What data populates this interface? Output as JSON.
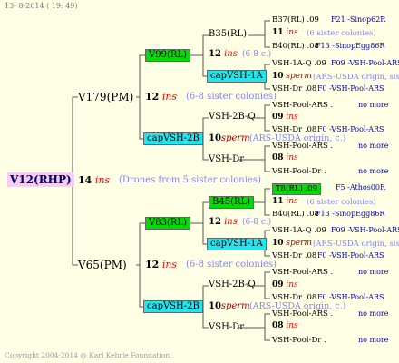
{
  "date": "13- 8-2014 ( 19: 49)",
  "root": "V12(RHP)",
  "root_ins": {
    "num": "14",
    "type": "ins",
    "note": "(Drones from 5 sister colonies)"
  },
  "sire_line": {
    "name": "V179(PM)",
    "ins": {
      "num": "12",
      "type": "ins",
      "note": "(6-8 sister colonies)"
    },
    "a": {
      "name": "V99(RL)",
      "ins": {
        "num": "12",
        "type": "ins",
        "note": "(6-8 c.)"
      },
      "a": {
        "name": "B35(RL)",
        "ins": {
          "num": "11",
          "type": "ins",
          "note": "(6 sister colonies)"
        },
        "a": {
          "name": "B37(RL) .09",
          "extra": "F21 -Sinop62R"
        },
        "b": {
          "name": "B40(RL) .08",
          "extra": "F13 -SinopEgg86R"
        }
      },
      "b": {
        "name": "capVSH-1A",
        "ins": {
          "num": "10",
          "type": "sperm",
          "note": "(ARS-USDA origin, sister"
        },
        "a": {
          "name": "VSH-1A-Q .09",
          "extra": "F09 -VSH-Pool-ARS"
        },
        "b": {
          "name": "VSH-Dr .08",
          "extra": "F0 -VSH-Pool-ARS"
        }
      }
    },
    "b": {
      "name": "capVSH-2B",
      "ins": {
        "num": "10",
        "type": "sperm",
        "note": "(ARS-USDA origin, c.)"
      },
      "a": {
        "name": "VSH-2B-Q",
        "ins": {
          "num": "09",
          "type": "ins",
          "note": ""
        },
        "a": {
          "name": "VSH-Pool-ARS .",
          "extra": "no more"
        },
        "b": {
          "name": "VSH-Dr .08",
          "extra": "F0 -VSH-Pool-ARS"
        }
      },
      "b": {
        "name": "VSH-Dr",
        "ins": {
          "num": "08",
          "type": "ins",
          "note": ""
        },
        "a": {
          "name": "VSH-Pool-ARS .",
          "extra": "no more"
        },
        "b": {
          "name": "VSH-Pool-Dr .",
          "extra": "no more"
        }
      }
    }
  },
  "dam_line": {
    "name": "V65(PM)",
    "ins": {
      "num": "12",
      "type": "ins",
      "note": "(6-8 sister colonies)"
    },
    "a": {
      "name": "V83(RL)",
      "ins": {
        "num": "12",
        "type": "ins",
        "note": "(6-8 c.)"
      },
      "a": {
        "name": "B45(RL)",
        "ins": {
          "num": "11",
          "type": "ins",
          "note": "(6 sister colonies)"
        },
        "a": {
          "name": "T8(RL) .09",
          "extra": "F5 -Athos00R"
        },
        "b": {
          "name": "B40(RL) .08",
          "extra": "F13 -SinopEgg86R"
        }
      },
      "b": {
        "name": "capVSH-1A",
        "ins": {
          "num": "10",
          "type": "sperm",
          "note": "(ARS-USDA origin, siste"
        },
        "a": {
          "name": "VSH-1A-Q .09",
          "extra": "F09 -VSH-Pool-ARS"
        },
        "b": {
          "name": "VSH-Dr .08",
          "extra": "F0 -VSH-Pool-ARS"
        }
      }
    },
    "b": {
      "name": "capVSH-2B",
      "ins": {
        "num": "10",
        "type": "sperm",
        "note": "(ARS-USDA origin, c.)"
      },
      "a": {
        "name": "VSH-2B-Q",
        "ins": {
          "num": "09",
          "type": "ins",
          "note": ""
        },
        "a": {
          "name": "VSH-Pool-ARS .",
          "extra": "no more"
        },
        "b": {
          "name": "VSH-Dr .08",
          "extra": "F0 -VSH-Pool-ARS"
        }
      },
      "b": {
        "name": "VSH-Dr",
        "ins": {
          "num": "08",
          "type": "ins",
          "note": ""
        },
        "a": {
          "name": "VSH-Pool-ARS .",
          "extra": "no more"
        },
        "b": {
          "name": "VSH-Pool-Dr .",
          "extra": "no more"
        }
      }
    }
  },
  "footer": "Copyright 2004-2014 @ Karl Kehrle Foundation.",
  "colors": {
    "root_bg": "#f7cdf7",
    "green_box": "#00dd00",
    "cyan_box": "#22e6ee",
    "ins_red": "#ff0000",
    "note_blue": "#8080ff",
    "background": "#ffffe6"
  }
}
